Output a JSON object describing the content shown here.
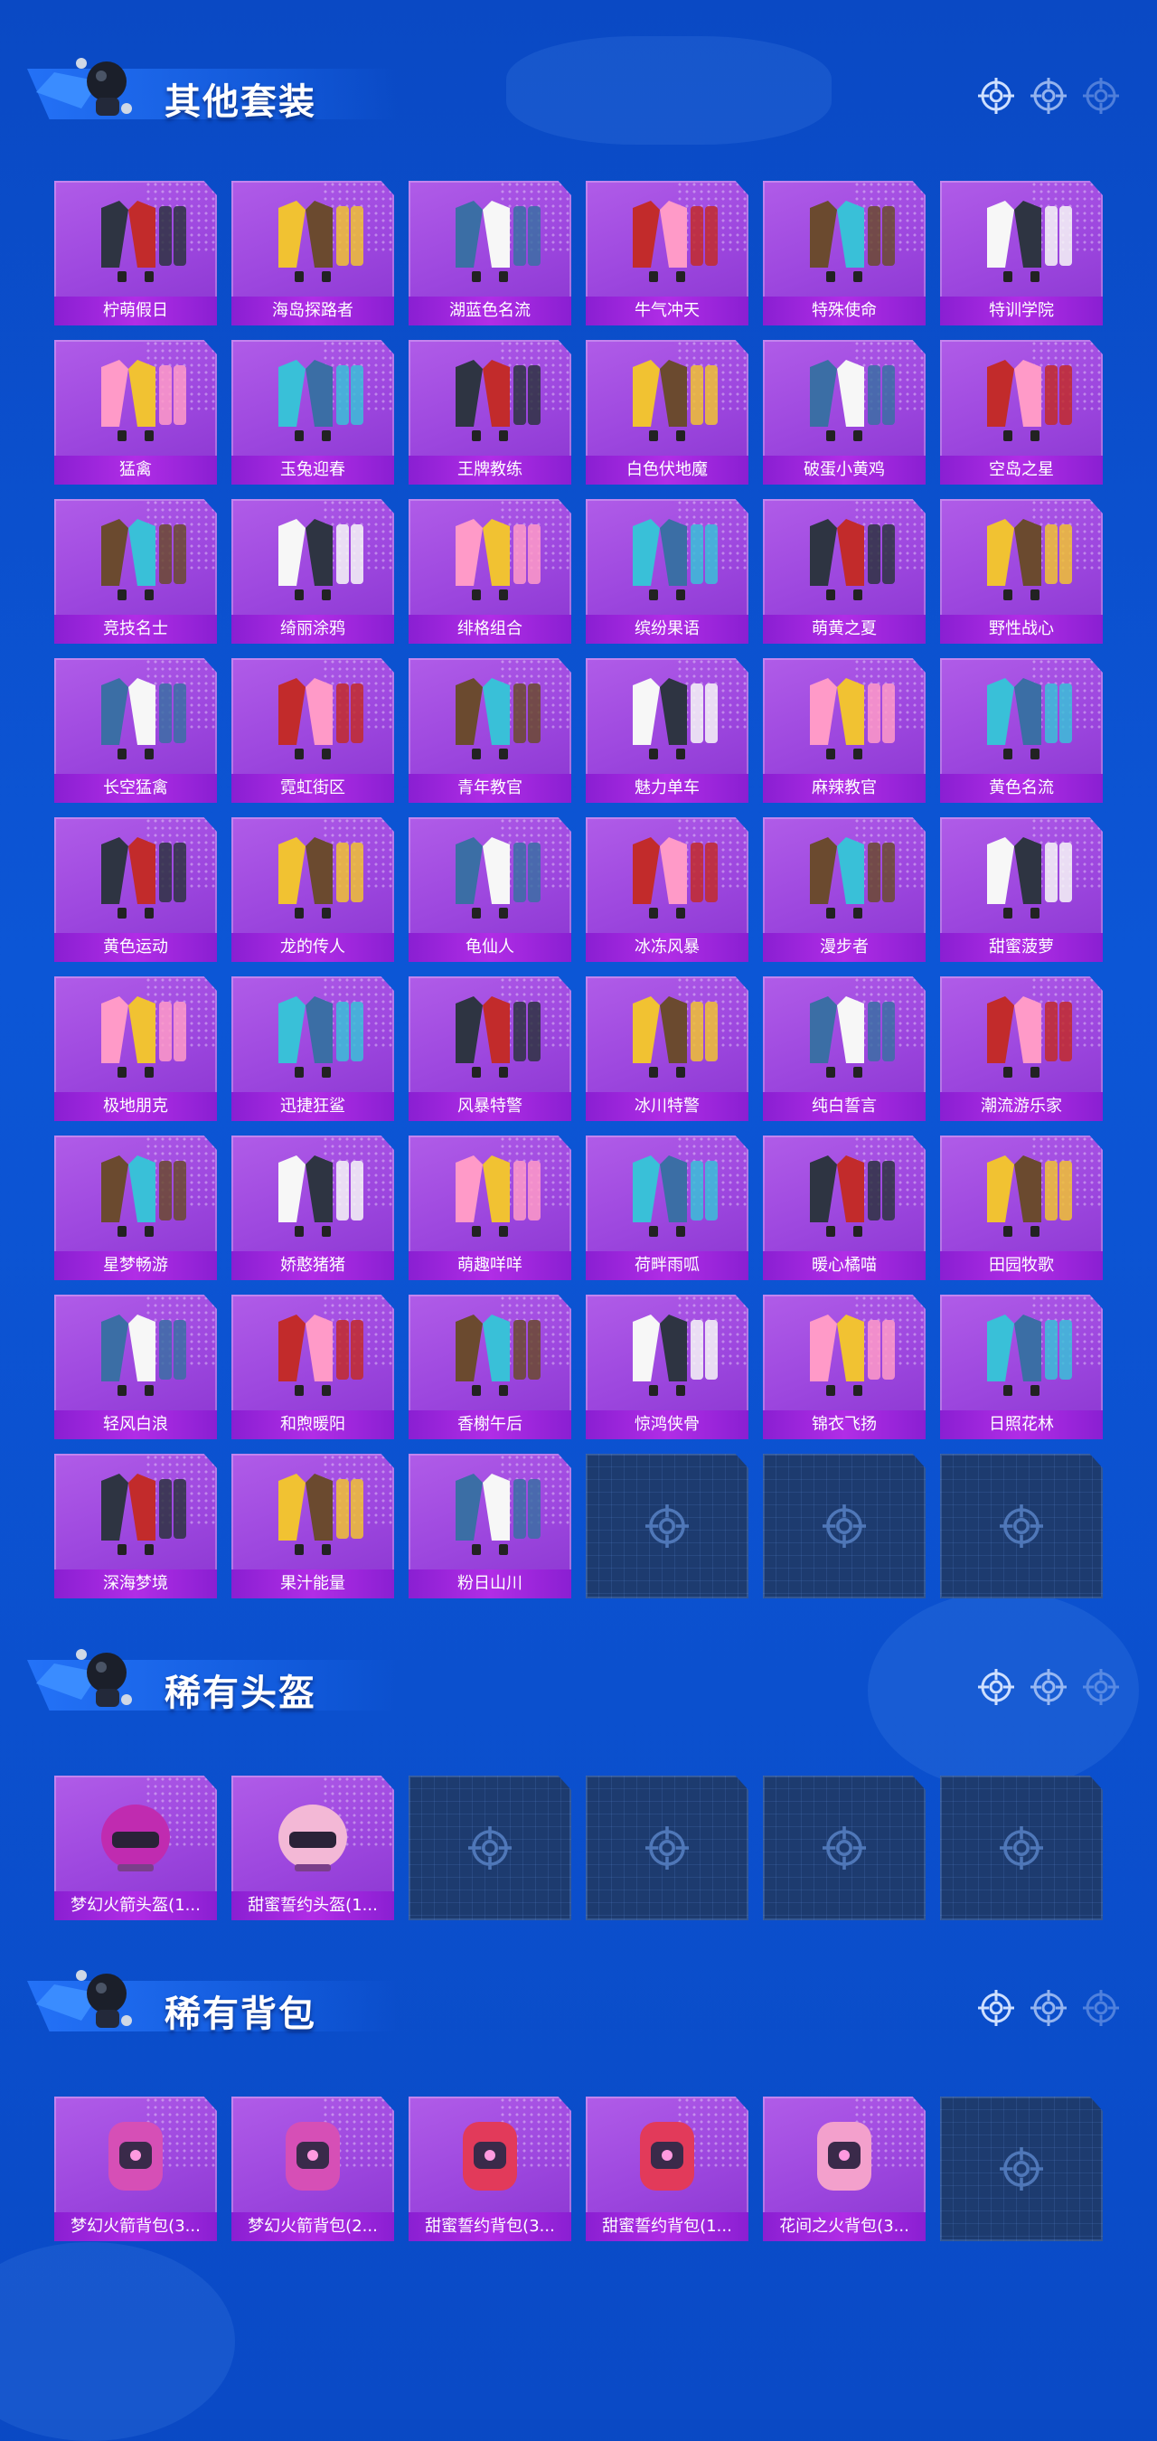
{
  "colors": {
    "background": "#0c56d6",
    "card": "#a24ee0",
    "label_bar": "#a126dc",
    "empty_slot": "#1d3b6f"
  },
  "sections": [
    {
      "title": "其他套装",
      "items": [
        "柠萌假日",
        "海岛探路者",
        "湖蓝色名流",
        "牛气冲天",
        "特殊使命",
        "特训学院",
        "猛禽",
        "玉兔迎春",
        "王牌教练",
        "白色伏地魔",
        "破蛋小黄鸡",
        "空岛之星",
        "竞技名士",
        "绮丽涂鸦",
        "绯格组合",
        "缤纷果语",
        "萌黄之夏",
        "野性战心",
        "长空猛禽",
        "霓虹街区",
        "青年教官",
        "魅力单车",
        "麻辣教官",
        "黄色名流",
        "黄色运动",
        "龙的传人",
        "龟仙人",
        "冰冻风暴",
        "漫步者",
        "甜蜜菠萝",
        "极地朋克",
        "迅捷狂鲨",
        "风暴特警",
        "冰川特警",
        "纯白誓言",
        "潮流游乐家",
        "星梦畅游",
        "娇憨猪猪",
        "萌趣咩咩",
        "荷畔雨呱",
        "暖心橘喵",
        "田园牧歌",
        "轻风白浪",
        "和煦暖阳",
        "香榭午后",
        "惊鸿侠骨",
        "锦衣飞扬",
        "日照花林",
        "深海梦境",
        "果汁能量",
        "粉日山川"
      ],
      "empty_slots": 3
    },
    {
      "title": "稀有头盔",
      "items": [
        "梦幻火箭头盔(1...",
        "甜蜜誓约头盔(1..."
      ],
      "empty_slots": 4
    },
    {
      "title": "稀有背包",
      "items": [
        "梦幻火箭背包(3...",
        "梦幻火箭背包(2...",
        "甜蜜誓约背包(3...",
        "甜蜜誓约背包(1...",
        "花间之火背包(3..."
      ],
      "empty_slots": 1
    }
  ]
}
